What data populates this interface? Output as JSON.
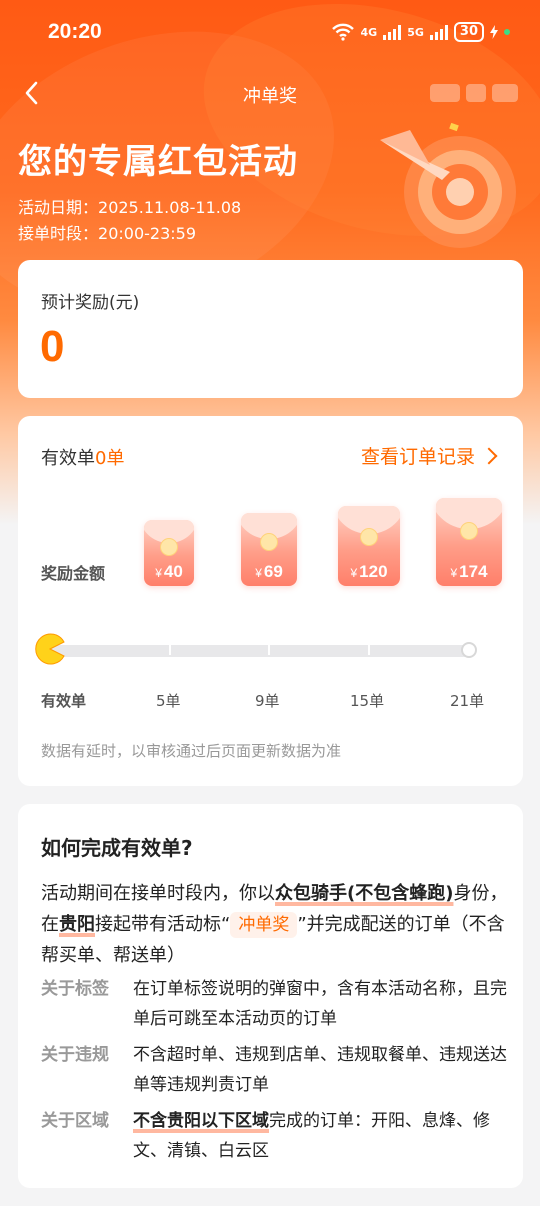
{
  "status_bar": {
    "time": "20:20",
    "network1": "4G",
    "network2": "5G",
    "battery": "30"
  },
  "nav": {
    "title": "冲单奖"
  },
  "hero": {
    "title": "您的专属红包活动",
    "date_label": "活动日期：",
    "date_value": "2025.11.08-11.08",
    "period_label": "接单时段：",
    "period_value": "20:00-23:59"
  },
  "reward_card": {
    "label": "预计奖励(元)",
    "value": "0"
  },
  "progress_card": {
    "valid_label": "有效单",
    "valid_count": "0单",
    "records_link": "查看订单记录",
    "amount_row_label": "奖励金额",
    "currency": "¥",
    "tiers": [
      {
        "amount": "40",
        "orders": "5单"
      },
      {
        "amount": "69",
        "orders": "9单"
      },
      {
        "amount": "120",
        "orders": "15单"
      },
      {
        "amount": "174",
        "orders": "21单"
      }
    ],
    "axis_start_label": "有效单",
    "progress_fraction": 0,
    "note": "数据有延时，以审核通过后页面更新数据为准"
  },
  "howto_card": {
    "title": "如何完成有效单?",
    "p1_a": "活动期间在接单时段内，你以",
    "p1_b": "众包骑手(不包含蜂跑)",
    "p1_c": "身份，在",
    "p1_d": "贵阳",
    "p1_e": "接起带有活动标“",
    "p1_tag": "冲单奖",
    "p1_f": "”并完成配送的订单（不含帮买单、帮送单）",
    "rules": [
      {
        "key": "关于标签",
        "value": "在订单标签说明的弹窗中，含有本活动名称，且完单后可跳至本活动页的订单"
      },
      {
        "key": "关于违规",
        "value": "不含超时单、违规到店单、违规取餐单、违规送达单等违规判责订单"
      }
    ],
    "area_key": "关于区域",
    "area_bold": "不含贵阳以下区域",
    "area_rest": "完成的订单：开阳、息烽、修文、清镇、白云区"
  }
}
